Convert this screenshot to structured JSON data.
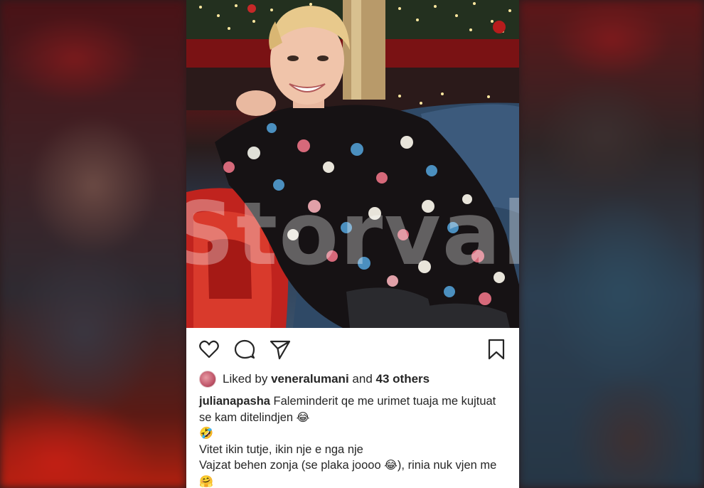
{
  "watermark": "Storval",
  "post": {
    "actions": {
      "like_icon": "heart-icon",
      "comment_icon": "comment-icon",
      "share_icon": "paper-plane-icon",
      "save_icon": "bookmark-icon"
    },
    "likes": {
      "prefix": "Liked by",
      "user": "veneralumani",
      "middle": "and",
      "others": "43 others"
    },
    "caption": {
      "username": "julianapasha",
      "line1": "Faleminderit qe me urimet tuaja me kujtuat se kam ditelindjen",
      "emoji1": "😂",
      "emoji2": "🤣",
      "line2": "Vitet ikin tutje, ikin nje e nga nje",
      "line3a": "Vajzat behen zonja (se plaka joooo",
      "emoji3": "😂",
      "line3b": "), rinia nuk vjen me",
      "emoji4": "🤗"
    }
  },
  "colors": {
    "text": "#262626",
    "icon": "#262626",
    "card": "#ffffff"
  }
}
